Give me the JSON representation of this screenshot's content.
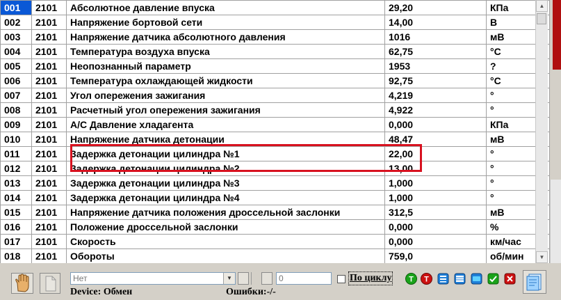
{
  "rows": [
    {
      "id": "001",
      "code": "2101",
      "name": "Абсолютное давление впуска",
      "value": "29,20",
      "unit": "КПа"
    },
    {
      "id": "002",
      "code": "2101",
      "name": "Напряжение бортовой сети",
      "value": "14,00",
      "unit": "В"
    },
    {
      "id": "003",
      "code": "2101",
      "name": "Напряжение датчика абсолютного давления",
      "value": "1016",
      "unit": "мВ"
    },
    {
      "id": "004",
      "code": "2101",
      "name": "Температура воздуха впуска",
      "value": "62,75",
      "unit": "°C"
    },
    {
      "id": "005",
      "code": "2101",
      "name": "Неопознанный параметр",
      "value": "1953",
      "unit": "?"
    },
    {
      "id": "006",
      "code": "2101",
      "name": "Температура охлаждающей жидкости",
      "value": "92,75",
      "unit": "°C"
    },
    {
      "id": "007",
      "code": "2101",
      "name": "Угол опережения зажигания",
      "value": "4,219",
      "unit": "°"
    },
    {
      "id": "008",
      "code": "2101",
      "name": "Расчетный угол опережения зажигания",
      "value": "4,922",
      "unit": "°"
    },
    {
      "id": "009",
      "code": "2101",
      "name": "A/C Давление хладагента",
      "value": "0,000",
      "unit": "КПа"
    },
    {
      "id": "010",
      "code": "2101",
      "name": "Напряжение датчика детонации",
      "value": "48,47",
      "unit": "мВ"
    },
    {
      "id": "011",
      "code": "2101",
      "name": "Задержка детонации цилиндра №1",
      "value": "22,00",
      "unit": "°"
    },
    {
      "id": "012",
      "code": "2101",
      "name": "Задержка детонации цилиндра №2",
      "value": "13,00",
      "unit": "°"
    },
    {
      "id": "013",
      "code": "2101",
      "name": "Задержка детонации цилиндра №3",
      "value": "1,000",
      "unit": "°"
    },
    {
      "id": "014",
      "code": "2101",
      "name": "Задержка детонации цилиндра №4",
      "value": "1,000",
      "unit": "°"
    },
    {
      "id": "015",
      "code": "2101",
      "name": "Напряжение датчика положения дроссельной заслонки",
      "value": "312,5",
      "unit": "мВ"
    },
    {
      "id": "016",
      "code": "2101",
      "name": "Положение дроссельной заслонки",
      "value": "0,000",
      "unit": "%"
    },
    {
      "id": "017",
      "code": "2101",
      "name": "Скорость",
      "value": "0,000",
      "unit": "км/час"
    },
    {
      "id": "018",
      "code": "2101",
      "name": "Обороты",
      "value": "759,0",
      "unit": "об/мин"
    }
  ],
  "toolbar": {
    "combo_value": "Нет",
    "number_value": "0",
    "cycle_label": "По циклу",
    "btn_t_green": "T",
    "btn_t_red": "T"
  },
  "status": {
    "device_label": "Device:",
    "device_value": "Обмен",
    "errors_label": "Ошибки:",
    "errors_value": "-/-"
  },
  "colors": {
    "selection": "#0a58d6",
    "highlight_frame": "#d8111f",
    "green_button": "#1aa31a",
    "red_button": "#cc1111",
    "blue_button": "#1e7fd8"
  }
}
